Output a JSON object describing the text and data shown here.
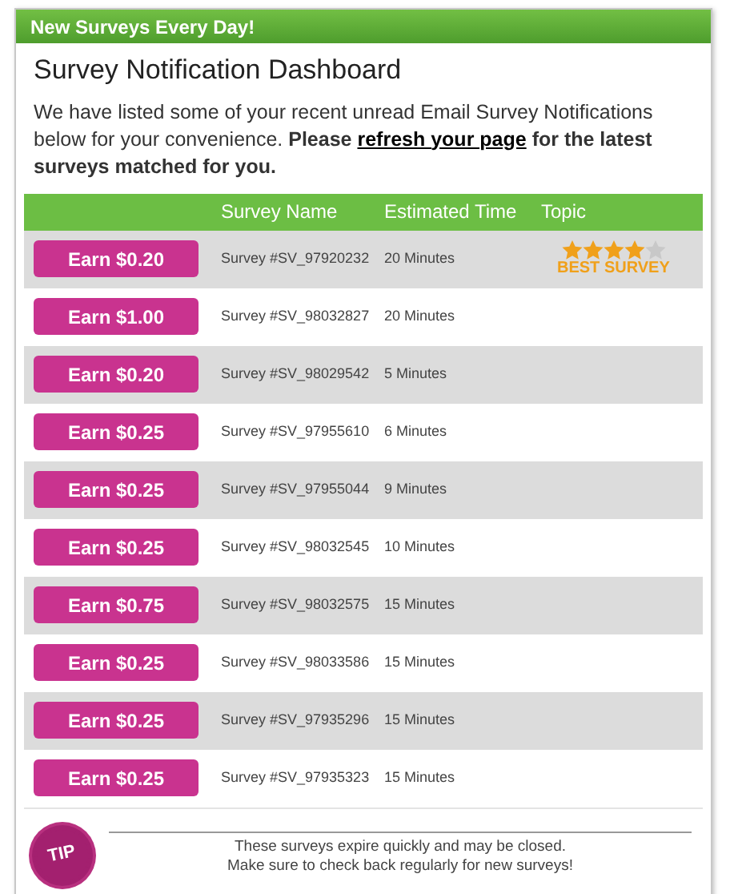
{
  "banner": {
    "title": "New Surveys Every Day!"
  },
  "heading": "Survey Notification Dashboard",
  "intro": {
    "text": "We have listed some of your recent unread Email Survey Notifications below for your convenience. **Please**",
    "link": "refresh your page",
    "after": "for the latest surveys matched for you."
  },
  "table": {
    "columns": [
      "Survey Name",
      "Estimated Time",
      "Topic"
    ],
    "rows": [
      {
        "button": "Earn $0.20",
        "name": "Survey #SV_97920232",
        "time": "20 Minutes",
        "topic": {
          "stars": 4,
          "label": "BEST SURVEY"
        }
      },
      {
        "button": "Earn $1.00",
        "name": "Survey #SV_98032827",
        "time": "20 Minutes"
      },
      {
        "button": "Earn $0.20",
        "name": "Survey #SV_98029542",
        "time": "5 Minutes"
      },
      {
        "button": "Earn $0.25",
        "name": "Survey #SV_97955610",
        "time": "6 Minutes"
      },
      {
        "button": "Earn $0.25",
        "name": "Survey #SV_97955044",
        "time": "9 Minutes"
      },
      {
        "button": "Earn $0.25",
        "name": "Survey #SV_98032545",
        "time": "10 Minutes"
      },
      {
        "button": "Earn $0.75",
        "name": "Survey #SV_98032575",
        "time": "15 Minutes"
      },
      {
        "button": "Earn $0.25",
        "name": "Survey #SV_98033586",
        "time": "15 Minutes"
      },
      {
        "button": "Earn $0.25",
        "name": "Survey #SV_97935296",
        "time": "15 Minutes"
      },
      {
        "button": "Earn $0.25",
        "name": "Survey #SV_97935323",
        "time": "15 Minutes"
      }
    ]
  },
  "tip": {
    "badge": "TIP",
    "lines": [
      "These surveys expire quickly and may be closed.",
      "Make sure to check back regularly for new surveys!"
    ]
  }
}
